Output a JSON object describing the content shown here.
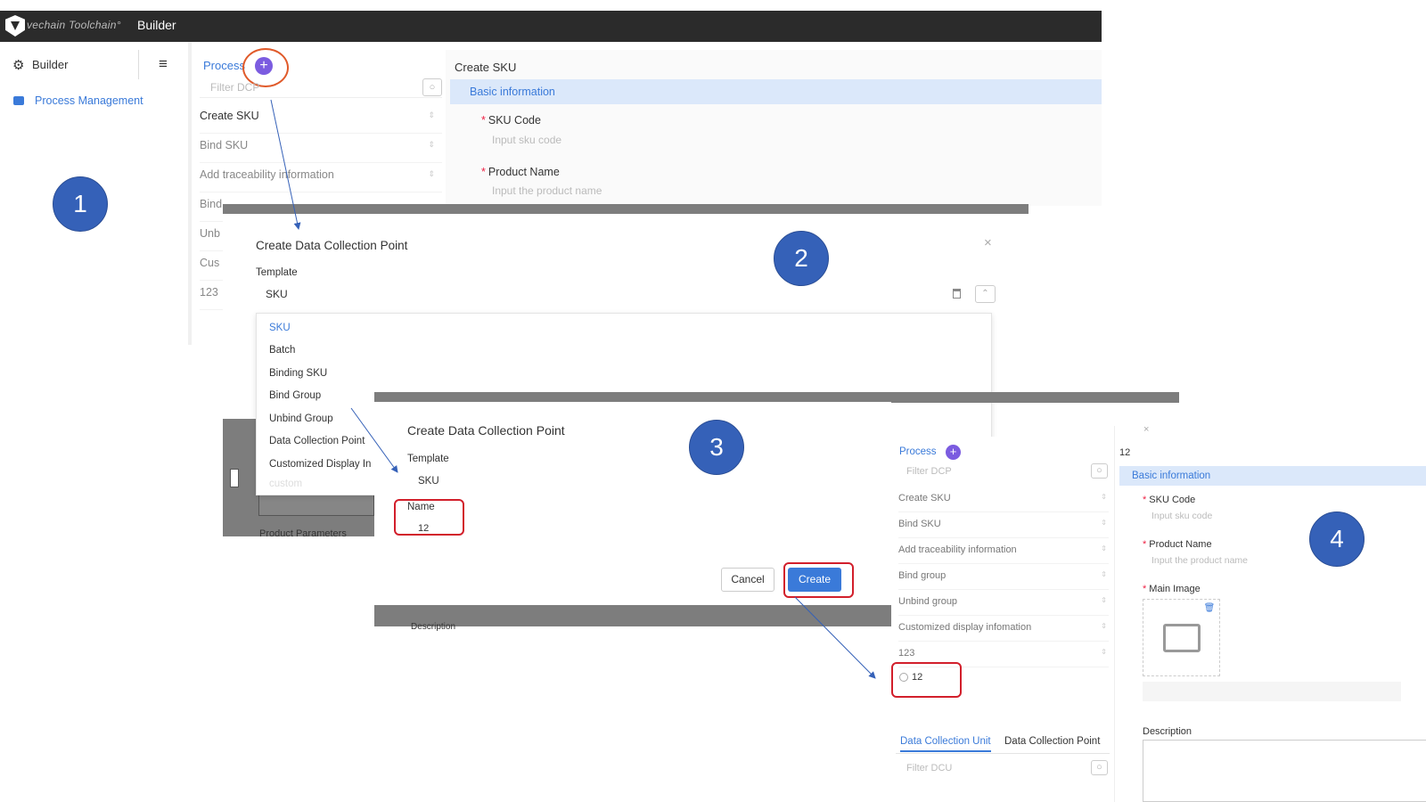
{
  "topbar": {
    "logo_text": "vechain Toolchain°",
    "title": "Builder"
  },
  "sidebar": {
    "builder_label": "Builder",
    "menu_icon": "hamburger-icon",
    "items": [
      {
        "label": "Process Management",
        "icon": "briefcase-icon"
      }
    ]
  },
  "markers": {
    "one": "1",
    "two": "2",
    "three": "3",
    "four": "4"
  },
  "panel1": {
    "process_label": "Process",
    "filter_placeholder": "Filter DCP",
    "items": [
      "Create SKU",
      "Bind SKU",
      "Add traceability information",
      "Bind",
      "Unb",
      "Cus",
      "123"
    ]
  },
  "create_sku_panel": {
    "title": "Create SKU",
    "section": "Basic information",
    "sku_code_label": "SKU Code",
    "sku_code_placeholder": "Input sku code",
    "product_name_label": "Product Name",
    "product_name_placeholder": "Input the product name"
  },
  "dialog2": {
    "title": "Create Data Collection Point",
    "template_label": "Template",
    "template_value": "SKU",
    "options": [
      "SKU",
      "Batch",
      "Binding SKU",
      "Bind Group",
      "Unbind Group",
      "Data Collection Point",
      "Customized Display In",
      "custom"
    ],
    "behind_text": "Product Parameters"
  },
  "dialog3": {
    "title": "Create Data Collection Point",
    "template_label": "Template",
    "template_value": "SKU",
    "name_label": "Name",
    "name_value": "12",
    "cancel_label": "Cancel",
    "create_label": "Create",
    "behind_text": "Description"
  },
  "panel4": {
    "process_label": "Process",
    "filter_placeholder": "Filter DCP",
    "items": [
      "Create SKU",
      "Bind SKU",
      "Add traceability information",
      "Bind group",
      "Unbind group",
      "Customized display infomation",
      "123"
    ],
    "new_item": "12",
    "tab_unit": "Data Collection Unit",
    "tab_point": "Data Collection Point",
    "filter_dcu_placeholder": "Filter DCU",
    "right": {
      "name": "12",
      "section": "Basic information",
      "sku_code_label": "SKU Code",
      "sku_code_placeholder": "Input sku code",
      "product_name_label": "Product Name",
      "product_name_placeholder": "Input the product name",
      "main_image_label": "Main Image",
      "description_label": "Description"
    }
  },
  "colors": {
    "accent": "#3a7ad9",
    "plus": "#7b5ce0",
    "highlight": "#d21f2b",
    "marker": "#3561b8"
  }
}
